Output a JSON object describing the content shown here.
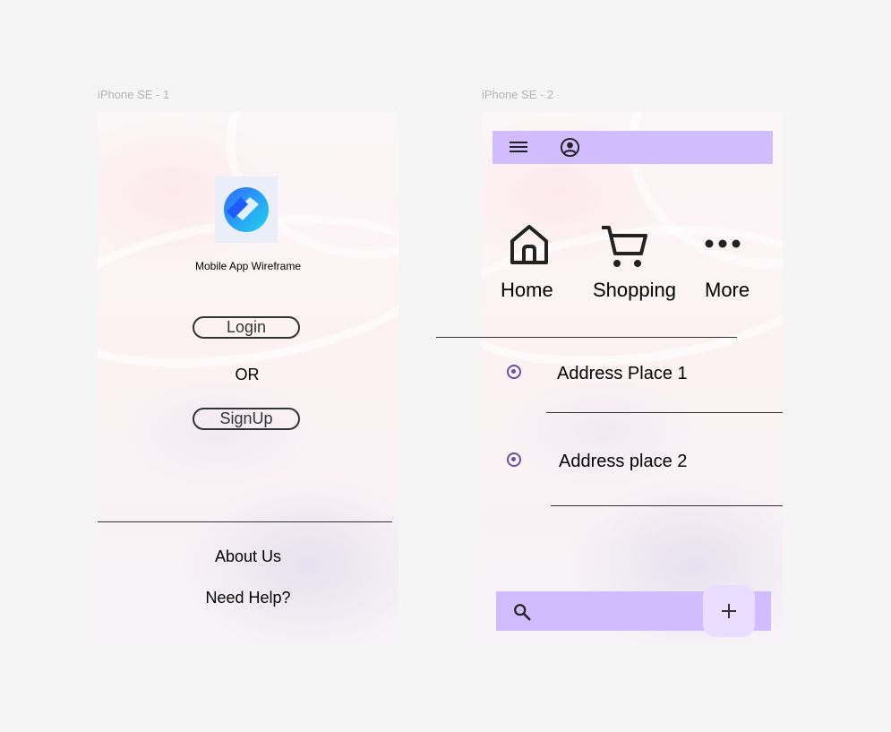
{
  "frames": [
    {
      "title": "iPhone SE - 1",
      "app_name": "Mobile App Wireframe",
      "login_label": "Login",
      "or_label": "OR",
      "signup_label": "SignUp",
      "about_label": "About Us",
      "help_label": "Need Help?"
    },
    {
      "title": "iPhone SE - 2",
      "nav": [
        {
          "label": "Home",
          "icon": "home-icon"
        },
        {
          "label": "Shopping",
          "icon": "cart-icon"
        },
        {
          "label": "More",
          "icon": "more-icon"
        }
      ],
      "addresses": [
        {
          "label": "Address Place 1",
          "selected": true
        },
        {
          "label": "Address place 2",
          "selected": true
        }
      ]
    }
  ],
  "colors": {
    "appbar": "#d0bcff",
    "fab": "#eaddff",
    "radio": "#6750a4",
    "canvas": "#f5f5f5"
  }
}
